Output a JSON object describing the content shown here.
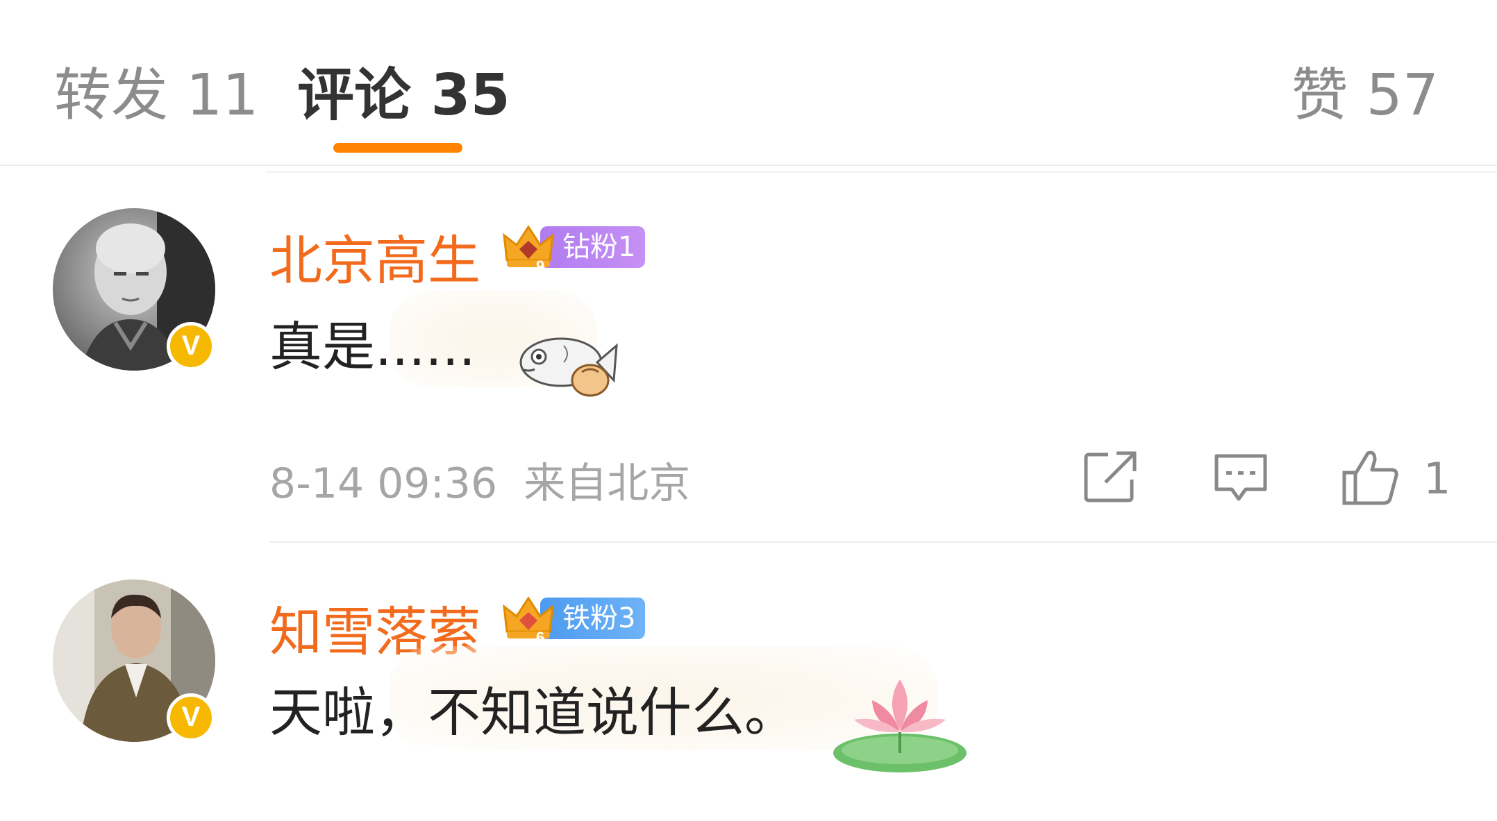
{
  "tabs": {
    "repost": "转发 11",
    "comment": "评论 35",
    "like": "赞 57",
    "active_color": "#ff8200"
  },
  "comments": [
    {
      "username": "北京高生",
      "fan_badge": "钻粉1",
      "fan_level": "9",
      "text": "真是......",
      "emoji": "fish-emoji",
      "time": "8-14 09:36",
      "source": "来自北京",
      "likes": "1",
      "verified": "V"
    },
    {
      "username": "知雪落萦",
      "fan_badge": "铁粉3",
      "fan_level": "6",
      "text": "天啦，不知道说什么。",
      "emoji": "lotus-emoji",
      "verified": "V"
    }
  ],
  "colors": {
    "username": "#f26b1d",
    "diamond_badge": "#b07cf0",
    "iron_badge": "#4c9bf0",
    "verified_badge": "#f6b800"
  },
  "icons": [
    "share-icon",
    "reply-icon",
    "thumbs-up-icon"
  ]
}
